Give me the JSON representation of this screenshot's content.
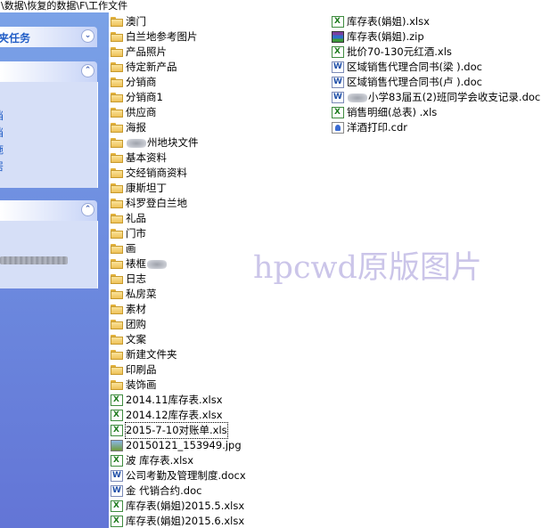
{
  "path_bar": "\\数据\\恢复的数据\\F\\工作文件",
  "task_pane": {
    "group1_title": "夹任务",
    "group2_links": [
      "档",
      "档",
      "施",
      "居"
    ]
  },
  "files_col1": [
    {
      "type": "folder",
      "name": "澳门"
    },
    {
      "type": "folder",
      "name": "白兰地参考图片"
    },
    {
      "type": "folder",
      "name": "产品照片"
    },
    {
      "type": "folder",
      "name": "待定新产品"
    },
    {
      "type": "folder",
      "name": "分销商"
    },
    {
      "type": "folder",
      "name": "分销商1"
    },
    {
      "type": "folder",
      "name": "供应商"
    },
    {
      "type": "folder",
      "name": "海报"
    },
    {
      "type": "folder",
      "name": "州地块文件",
      "blur_before": true
    },
    {
      "type": "folder",
      "name": "基本资料"
    },
    {
      "type": "folder",
      "name": "交经销商资料"
    },
    {
      "type": "folder",
      "name": "康斯坦丁"
    },
    {
      "type": "folder",
      "name": "科罗登白兰地"
    },
    {
      "type": "folder",
      "name": "礼品"
    },
    {
      "type": "folder",
      "name": "门市"
    },
    {
      "type": "folder",
      "name": "画"
    },
    {
      "type": "folder",
      "name": "裱框",
      "blur_after": true
    },
    {
      "type": "folder",
      "name": "日志"
    },
    {
      "type": "folder",
      "name": "私房菜"
    },
    {
      "type": "folder",
      "name": "素材"
    },
    {
      "type": "folder",
      "name": "团购"
    },
    {
      "type": "folder",
      "name": "文案"
    },
    {
      "type": "folder",
      "name": "新建文件夹"
    },
    {
      "type": "folder",
      "name": "印刷品"
    },
    {
      "type": "folder",
      "name": "装饰画"
    },
    {
      "type": "xls",
      "name": "2014.11库存表.xlsx"
    },
    {
      "type": "xls",
      "name": "2014.12库存表.xlsx"
    },
    {
      "type": "xls",
      "name": "2015-7-10对账单.xls",
      "selected": true
    },
    {
      "type": "jpg",
      "name": "20150121_153949.jpg"
    },
    {
      "type": "xls",
      "name": "波  库存表.xlsx"
    },
    {
      "type": "doc",
      "name": "公司考勤及管理制度.docx"
    },
    {
      "type": "doc",
      "name": "金  代销合约.doc"
    },
    {
      "type": "xls",
      "name": "库存表(娟姐)2015.5.xlsx"
    },
    {
      "type": "xls",
      "name": "库存表(娟姐)2015.6.xlsx"
    }
  ],
  "files_col2": [
    {
      "type": "xls",
      "name": "库存表(娟姐).xlsx"
    },
    {
      "type": "zip",
      "name": "库存表(娟姐).zip"
    },
    {
      "type": "xls",
      "name": "批价70-130元红酒.xls"
    },
    {
      "type": "doc",
      "name": "区域销售代理合同书(梁     ).doc"
    },
    {
      "type": "doc",
      "name": "区域销售代理合同书(卢     ).doc"
    },
    {
      "type": "doc",
      "name": "小学83届五(2)班同学会收支记录.doc",
      "blur_before": true
    },
    {
      "type": "xls",
      "name": "销售明细(总表) .xls"
    },
    {
      "type": "cdr",
      "name": "洋酒打印.cdr"
    }
  ],
  "watermark": "hpcwd原版图片"
}
